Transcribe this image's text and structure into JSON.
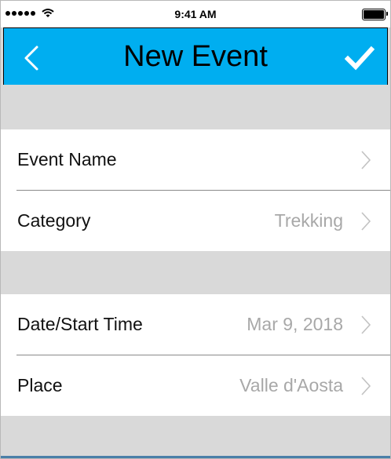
{
  "status_bar": {
    "time": "9:41 AM",
    "signal_icon": "cellular-signal-icon",
    "wifi_icon": "wifi-icon",
    "battery_icon": "battery-icon"
  },
  "nav_bar": {
    "title": "New Event",
    "back_icon": "chevron-left-icon",
    "done_icon": "checkmark-icon",
    "background_color": "#00aef0"
  },
  "sections": [
    {
      "rows": [
        {
          "label": "Event Name",
          "value": "",
          "icon": "chevron-right-icon"
        },
        {
          "label": "Category",
          "value": "Trekking",
          "icon": "chevron-right-icon"
        }
      ]
    },
    {
      "rows": [
        {
          "label": "Date/Start Time",
          "value": "Mar 9, 2018",
          "icon": "chevron-right-icon"
        },
        {
          "label": "Place",
          "value": "Valle d'Aosta",
          "icon": "chevron-right-icon"
        }
      ]
    }
  ]
}
